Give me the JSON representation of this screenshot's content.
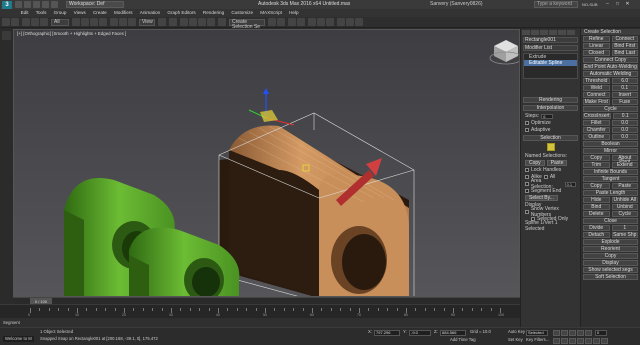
{
  "app": {
    "logo": "3",
    "workspace": "Workspace: Def",
    "title": "Autodesk 3ds Max 2016 x64    Untitled.max",
    "user": "Sanvery (Sanvery0826)",
    "search_placeholder": "Type a keyword",
    "account": "NO-SUB"
  },
  "menu": [
    "Edit",
    "Tools",
    "Group",
    "Views",
    "Create",
    "Modifiers",
    "Animation",
    "Graph Editors",
    "Rendering",
    "Customize",
    "MAXScript",
    "Help"
  ],
  "toolbar": {
    "selection_filter": "All",
    "view_dropdown": "View",
    "named_sel": "Create Selection Se"
  },
  "viewport": {
    "label": "[+] [Orthographic] [Smooth + Highlights + Edged Faces ]",
    "background": "#444448",
    "colors": {
      "green": "#5aa22a",
      "orange": "#c98f5a"
    }
  },
  "command_panel": {
    "object_name": "Rectangle001",
    "modifier_list": "Modifier List",
    "stack": [
      "Extrude",
      "Editable Spline"
    ],
    "stack_selected_index": 1,
    "rollouts": {
      "rendering": "Rendering",
      "interpolation": "Interpolation",
      "steps_label": "Steps:",
      "steps_value": "6",
      "optimize": "Optimize",
      "adaptive": "Adaptive",
      "selection": "Selection",
      "named_selections": "Named Selections:",
      "copy": "Copy",
      "paste": "Paste",
      "lock_handles": "Lock Handles",
      "alike": "Alike",
      "all": "All",
      "area_selection": "Area Selection:",
      "area_value": "0.1",
      "segment_end": "Segment End",
      "select_by": "Select By...",
      "display": "Display",
      "show_vertex_numbers": "Show Vertex Numbers",
      "selected_only": "Selected Only",
      "status": "Spline 1/Vert 1 Selected"
    }
  },
  "right_column": {
    "header": "Create Selection",
    "rows": [
      [
        "Refine",
        "Connect"
      ],
      [
        "Linear",
        "Bind First"
      ],
      [
        "Closed",
        "Bind Last"
      ],
      [
        "Connect Copy"
      ],
      [
        "End Point Auto-Welding"
      ],
      [
        "Automatic Welding"
      ],
      [
        "Threshold",
        "6.0"
      ],
      [
        "Weld",
        "0.1"
      ],
      [
        "Connect",
        "Insert"
      ],
      [
        "Make First",
        "Fuse"
      ],
      [
        "Cycle"
      ],
      [
        "CrossInsert",
        "0.1"
      ],
      [
        "Fillet",
        "0.0"
      ],
      [
        "Chamfer",
        "0.0"
      ],
      [
        "Outline",
        "0.0"
      ],
      [
        "Boolean"
      ],
      [
        "Mirror"
      ],
      [
        "Copy",
        "About Pivot"
      ],
      [
        "Trim",
        "Extend"
      ],
      [
        "Infinite Bounds"
      ],
      [
        "Tangent"
      ],
      [
        "Copy",
        "Paste"
      ],
      [
        "Paste Length"
      ],
      [
        "Hide",
        "Unhide All"
      ],
      [
        "Bind",
        "Unbind"
      ],
      [
        "Delete",
        "Cycle"
      ],
      [
        "Close"
      ],
      [
        "Divide",
        "1"
      ],
      [
        "Detach",
        "Same Shp"
      ],
      [
        "Explode"
      ],
      [
        "Reorient"
      ],
      [
        "Copy"
      ],
      [
        "Display"
      ],
      [
        "Show selected segs"
      ],
      [
        "Soft Selection"
      ]
    ]
  },
  "timeline": {
    "slider": "0 / 100",
    "ticks": [
      "0",
      "10",
      "20",
      "30",
      "40",
      "50",
      "60",
      "70",
      "80",
      "90",
      "100"
    ]
  },
  "status": {
    "welcome": "Welcome to M",
    "selected": "1 Object Selected",
    "prompt": "Snapped Snap on Rectangle001 at [200.168, -39.1, 0], 175.472",
    "x_label": "X:",
    "x_value": "797.296",
    "y_label": "Y:",
    "y_value": "-9.0",
    "z_label": "Z:",
    "z_value": "684.566",
    "grid": "Grid = 10.0",
    "add_time_tag": "Add Time Tag",
    "auto_key": "Auto Key",
    "selected_dropdown": "Selected",
    "set_key": "Set Key",
    "key_filters": "Key Filters...",
    "frame": "0",
    "segment": "Segment"
  }
}
